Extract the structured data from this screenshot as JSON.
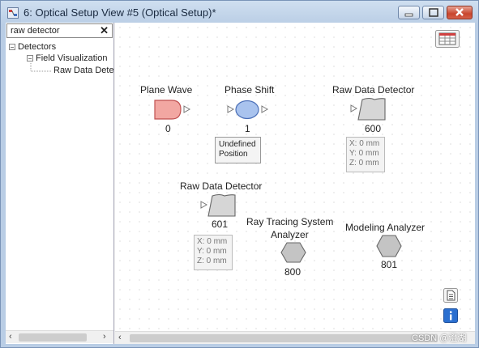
{
  "window": {
    "title": "6: Optical Setup View #5 (Optical Setup)*"
  },
  "search": {
    "value": "raw detector",
    "clear_glyph": "✕"
  },
  "tree": {
    "items": [
      {
        "label": "Detectors",
        "expander": "−"
      },
      {
        "label": "Field Visualization",
        "expander": "−"
      },
      {
        "label": "Raw Data Detector"
      }
    ]
  },
  "scroll": {
    "left_arrow": "‹",
    "right_arrow": "›"
  },
  "components": [
    {
      "label": "Plane Wave",
      "number": "0",
      "icon": "plane-wave-icon"
    },
    {
      "label": "Phase Shift",
      "number": "1",
      "icon": "phase-shift-icon",
      "info": [
        "Undefined",
        "Position"
      ]
    },
    {
      "label": "Raw Data Detector",
      "number": "600",
      "icon": "detector-icon",
      "info": [
        "X: 0 mm",
        "Y: 0 mm",
        "Z: 0 mm"
      ]
    },
    {
      "label": "Raw Data Detector",
      "number": "601",
      "icon": "detector-icon",
      "info": [
        "X: 0 mm",
        "Y: 0 mm",
        "Z: 0 mm"
      ]
    },
    {
      "label_line1": "Ray Tracing System",
      "label_line2": "Analyzer",
      "number": "800",
      "icon": "analyzer-icon"
    },
    {
      "label": "Modeling Analyzer",
      "number": "801",
      "icon": "analyzer-icon"
    }
  ],
  "watermark": "CSDN @澄湖",
  "colors": {
    "plane_wave_fill": "#f2a7a2",
    "phase_shift_fill": "#a9c3ee",
    "detector_fill": "#d6d6d6",
    "analyzer_fill": "#c4c4c4",
    "close_button": "#c8452d"
  }
}
